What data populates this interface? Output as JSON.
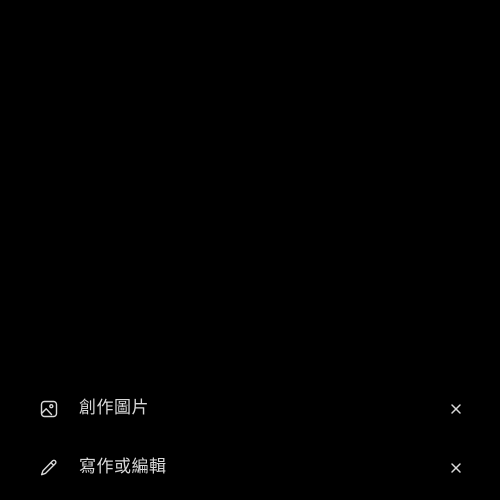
{
  "suggestions": [
    {
      "icon": "image-icon",
      "label": "創作圖片",
      "close_icon": "close-icon"
    },
    {
      "icon": "pencil-icon",
      "label": "寫作或編輯",
      "close_icon": "close-icon"
    }
  ],
  "colors": {
    "background": "#000000",
    "text": "#d9d9d9",
    "icon": "#d9d9d9"
  }
}
